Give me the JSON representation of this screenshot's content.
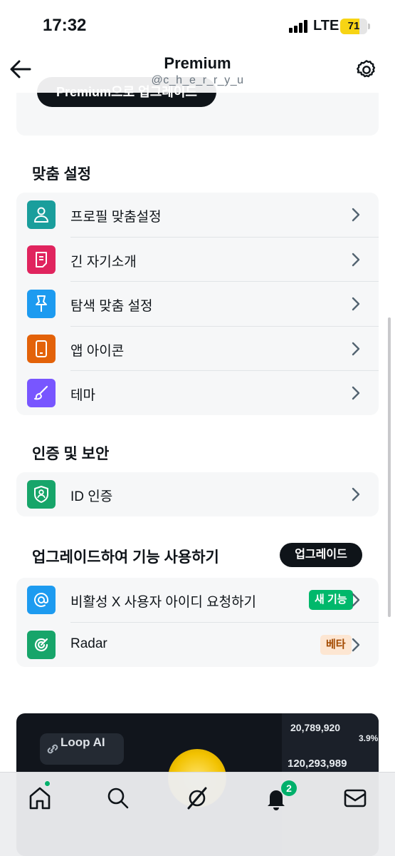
{
  "status_bar": {
    "time": "17:32",
    "network": "LTE",
    "battery": "71",
    "battery_level": 0.71,
    "battery_color": "#f7d414"
  },
  "header": {
    "title": "Premium",
    "subtitle": "@c_h_e_r_r_y_u"
  },
  "top_card": {
    "button_label": "Premium으로 업그레이드"
  },
  "sections": {
    "customize": {
      "title": "맞춤 설정",
      "items": [
        {
          "label": "프로필 맞춤설정",
          "icon": "person-icon",
          "color": "#1a9e9c"
        },
        {
          "label": "긴 자기소개",
          "icon": "document-icon",
          "color": "#e0245e"
        },
        {
          "label": "탐색 맞춤 설정",
          "icon": "pin-icon",
          "color": "#1d9bf0"
        },
        {
          "label": "앱 아이콘",
          "icon": "phone-icon",
          "color": "#e36209"
        },
        {
          "label": "테마",
          "icon": "brush-icon",
          "color": "#7856ff"
        }
      ]
    },
    "security": {
      "title": "인증 및 보안",
      "items": [
        {
          "label": "ID 인증",
          "icon": "shield-person-icon",
          "color": "#17a56a"
        }
      ]
    },
    "upgrade": {
      "title": "업그레이드하여 기능 사용하기",
      "button_label": "업그레이드",
      "items": [
        {
          "label": "비활성 X 사용자 아이디 요청하기",
          "icon": "at-icon",
          "color": "#1d9bf0",
          "badge": "새 기능",
          "badge_bg": "#00b86b",
          "badge_fg": "#ffffff"
        },
        {
          "label": "Radar",
          "icon": "radar-icon",
          "color": "#17a56a",
          "badge": "베타",
          "badge_bg": "#fde6d2",
          "badge_fg": "#a34a00"
        }
      ]
    }
  },
  "promo": {
    "chip_label": "Loop AI",
    "stats": [
      "20,789,920",
      "3.9%",
      "120,293,989"
    ]
  },
  "tab_bar": {
    "tabs": [
      "home-icon",
      "search-icon",
      "grok-icon",
      "bell-icon",
      "mail-icon"
    ],
    "notification_count": "2"
  }
}
